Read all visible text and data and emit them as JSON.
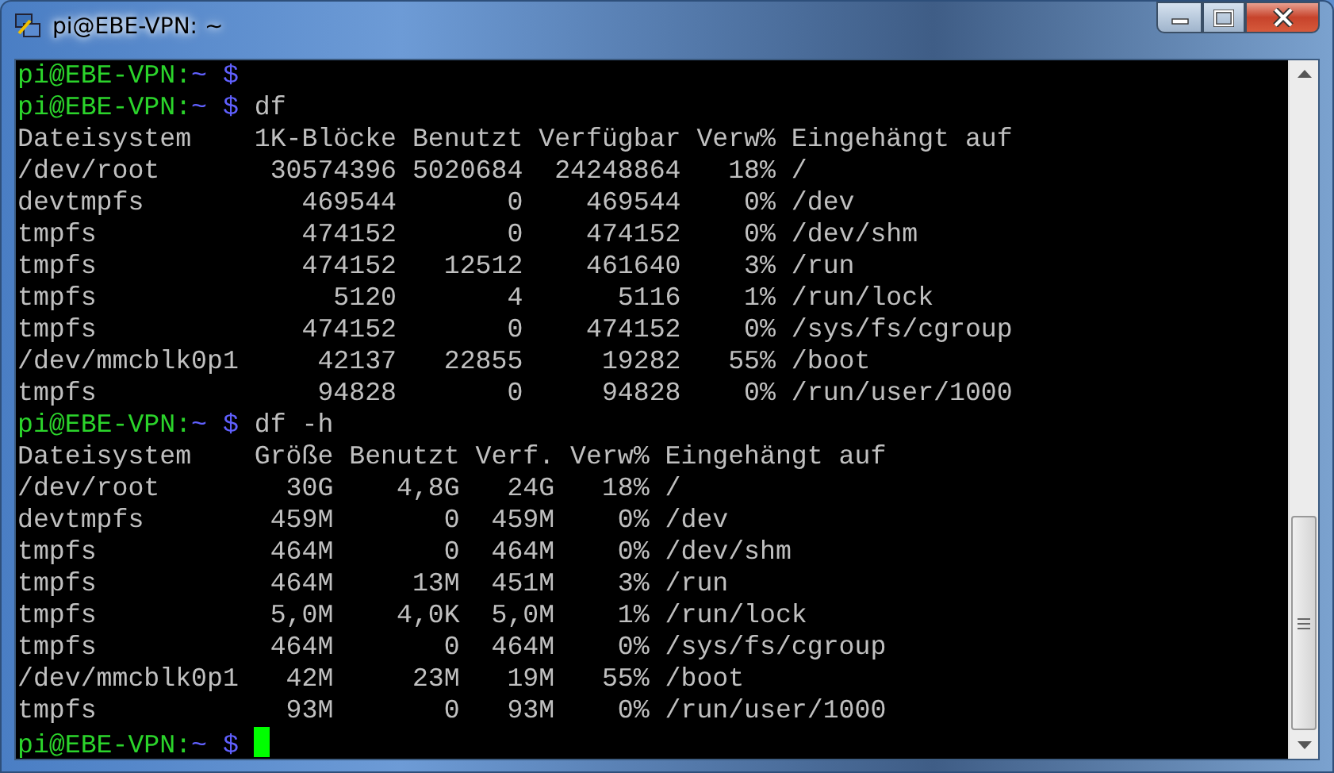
{
  "window": {
    "title": "pi@EBE-VPN: ~"
  },
  "terminal": {
    "lines": [
      {
        "kind": "prompt",
        "host": "pi@EBE-VPN:",
        "path": "~",
        "symbol": "$"
      },
      {
        "kind": "prompt",
        "host": "pi@EBE-VPN:",
        "path": "~",
        "symbol": "$",
        "command": "df"
      },
      {
        "kind": "output",
        "text": "Dateisystem    1K-Blöcke Benutzt Verfügbar Verw% Eingehängt auf"
      },
      {
        "kind": "output",
        "text": "/dev/root       30574396 5020684  24248864   18% /"
      },
      {
        "kind": "output",
        "text": "devtmpfs          469544       0    469544    0% /dev"
      },
      {
        "kind": "output",
        "text": "tmpfs             474152       0    474152    0% /dev/shm"
      },
      {
        "kind": "output",
        "text": "tmpfs             474152   12512    461640    3% /run"
      },
      {
        "kind": "output",
        "text": "tmpfs               5120       4      5116    1% /run/lock"
      },
      {
        "kind": "output",
        "text": "tmpfs             474152       0    474152    0% /sys/fs/cgroup"
      },
      {
        "kind": "output",
        "text": "/dev/mmcblk0p1     42137   22855     19282   55% /boot"
      },
      {
        "kind": "output",
        "text": "tmpfs              94828       0     94828    0% /run/user/1000"
      },
      {
        "kind": "prompt",
        "host": "pi@EBE-VPN:",
        "path": "~",
        "symbol": "$",
        "command": "df -h"
      },
      {
        "kind": "output",
        "text": "Dateisystem    Größe Benutzt Verf. Verw% Eingehängt auf"
      },
      {
        "kind": "output",
        "text": "/dev/root        30G    4,8G   24G   18% /"
      },
      {
        "kind": "output",
        "text": "devtmpfs        459M       0  459M    0% /dev"
      },
      {
        "kind": "output",
        "text": "tmpfs           464M       0  464M    0% /dev/shm"
      },
      {
        "kind": "output",
        "text": "tmpfs           464M     13M  451M    3% /run"
      },
      {
        "kind": "output",
        "text": "tmpfs           5,0M    4,0K  5,0M    1% /run/lock"
      },
      {
        "kind": "output",
        "text": "tmpfs           464M       0  464M    0% /sys/fs/cgroup"
      },
      {
        "kind": "output",
        "text": "/dev/mmcblk0p1   42M     23M   19M   55% /boot"
      },
      {
        "kind": "output",
        "text": "tmpfs            93M       0   93M    0% /run/user/1000"
      },
      {
        "kind": "prompt",
        "host": "pi@EBE-VPN:",
        "path": "~",
        "symbol": "$",
        "cursor": true
      }
    ]
  }
}
